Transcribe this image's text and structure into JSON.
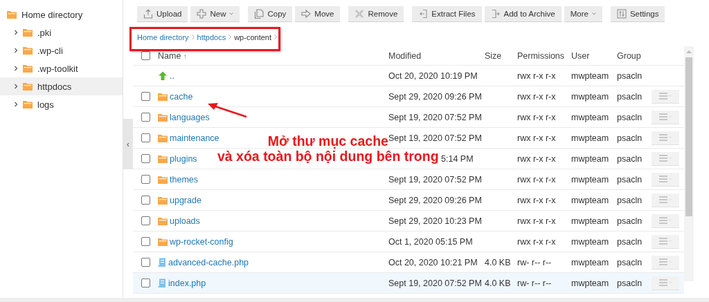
{
  "sidebar": {
    "root": {
      "label": "Home directory"
    },
    "items": [
      {
        "label": ".pki",
        "expanded": false,
        "selected": false
      },
      {
        "label": ".wp-cli",
        "expanded": false,
        "selected": false
      },
      {
        "label": ".wp-toolkit",
        "expanded": false,
        "selected": false
      },
      {
        "label": "httpdocs",
        "expanded": false,
        "selected": true
      },
      {
        "label": "logs",
        "expanded": false,
        "selected": false
      }
    ]
  },
  "collapse_handle": {
    "label": "‹"
  },
  "toolbar": [
    {
      "buttons": [
        {
          "label": "Upload",
          "dropdown": false
        },
        {
          "label": "New",
          "dropdown": true
        }
      ]
    },
    {
      "buttons": [
        {
          "label": "Copy",
          "dropdown": false
        },
        {
          "label": "Move",
          "dropdown": false
        }
      ]
    },
    {
      "buttons": [
        {
          "label": "Remove",
          "dropdown": false
        }
      ]
    },
    {
      "buttons": [
        {
          "label": "Extract Files",
          "dropdown": false
        },
        {
          "label": "Add to Archive",
          "dropdown": false
        }
      ]
    },
    {
      "buttons": [
        {
          "label": "More",
          "dropdown": true
        }
      ]
    },
    {
      "buttons": [
        {
          "label": "Settings",
          "dropdown": false
        }
      ]
    }
  ],
  "breadcrumb": [
    "Home directory",
    "httpdocs",
    "wp-content"
  ],
  "table": {
    "columns": [
      "Name",
      "Modified",
      "Size",
      "Permissions",
      "User",
      "Group"
    ],
    "sort_mark": "↑",
    "select_all": {
      "checked": false
    },
    "rows": [
      {
        "kind": "parent",
        "name": "..",
        "modified": "Oct 20, 2020 10:19 PM",
        "obscured": false,
        "permissions": "rwx r-x r-x",
        "user": "mwpteam",
        "group": "psacln",
        "highlighted": false
      },
      {
        "kind": "folder",
        "name": "cache",
        "modified": "Sept 29, 2020 09:26 PM",
        "obscured": false,
        "permissions": "rwx r-x r-x",
        "user": "mwpteam",
        "group": "psacln",
        "checked": false,
        "highlighted": false
      },
      {
        "kind": "folder",
        "name": "languages",
        "modified": "Sept 19, 2020 07:52 PM",
        "obscured": false,
        "permissions": "rwx r-x r-x",
        "user": "mwpteam",
        "group": "psacln",
        "checked": false,
        "highlighted": false
      },
      {
        "kind": "folder",
        "name": "maintenance",
        "modified": "Sept 19, 2020 07:52 PM",
        "obscured": false,
        "permissions": "rwx r-x r-x",
        "user": "mwpteam",
        "group": "psacln",
        "checked": false,
        "highlighted": false
      },
      {
        "kind": "folder",
        "name": "plugins",
        "modified": "5:14 PM",
        "obscured": true,
        "permissions": "rwx r-x r-x",
        "user": "mwpteam",
        "group": "psacln",
        "checked": false,
        "highlighted": false
      },
      {
        "kind": "folder",
        "name": "themes",
        "modified": "Sept 19, 2020 07:52 PM",
        "obscured": false,
        "permissions": "rwx r-x r-x",
        "user": "mwpteam",
        "group": "psacln",
        "checked": false,
        "highlighted": false
      },
      {
        "kind": "folder",
        "name": "upgrade",
        "modified": "Sept 29, 2020 09:26 PM",
        "obscured": false,
        "permissions": "rwx r-x r-x",
        "user": "mwpteam",
        "group": "psacln",
        "checked": false,
        "highlighted": false
      },
      {
        "kind": "folder",
        "name": "uploads",
        "modified": "Sept 29, 2020 10:23 PM",
        "obscured": false,
        "permissions": "rwx r-x r-x",
        "user": "mwpteam",
        "group": "psacln",
        "checked": false,
        "highlighted": false
      },
      {
        "kind": "folder",
        "name": "wp-rocket-config",
        "modified": "Oct 1, 2020 05:15 PM",
        "obscured": false,
        "permissions": "rwx r-x r-x",
        "user": "mwpteam",
        "group": "psacln",
        "checked": false,
        "highlighted": false
      },
      {
        "kind": "file",
        "name": "advanced-cache.php",
        "modified": "Oct 20, 2020 10:21 PM",
        "obscured": false,
        "size": "4.0 KB",
        "permissions": "rw- r-- r--",
        "user": "mwpteam",
        "group": "psacln",
        "checked": false,
        "highlighted": false
      },
      {
        "kind": "file",
        "name": "index.php",
        "modified": "Sept 19, 2020 07:52 PM",
        "obscured": false,
        "size": "4.0 KB",
        "permissions": "rw- r-- r--",
        "user": "mwpteam",
        "group": "psacln",
        "checked": false,
        "highlighted": true
      }
    ]
  },
  "annotation": {
    "lines": [
      "Mở thư mục cache",
      "và xóa toàn bộ nội dung bên trong"
    ]
  }
}
